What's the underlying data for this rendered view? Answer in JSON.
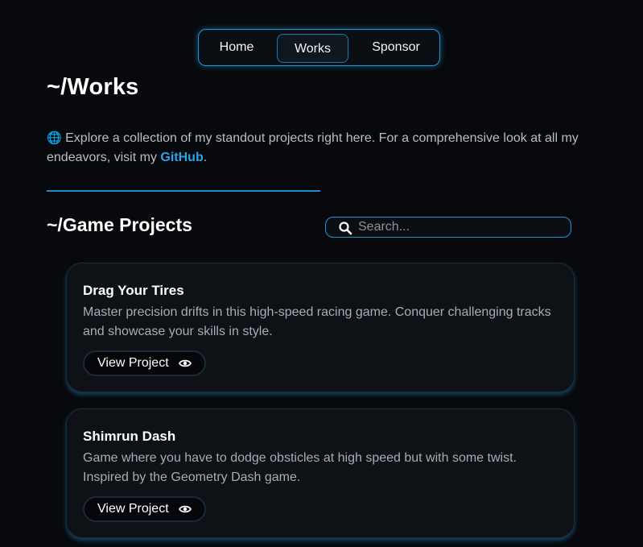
{
  "nav": {
    "items": [
      {
        "label": "Home"
      },
      {
        "label": "Works"
      },
      {
        "label": "Sponsor"
      }
    ]
  },
  "header": {
    "title": "~/Works"
  },
  "intro": {
    "globe": "🌐",
    "text_before": " Explore a collection of my standout projects right here. For a comprehensive look at all my endeavors, visit my ",
    "link_label": "GitHub",
    "text_after": "."
  },
  "section": {
    "title": "~/Game Projects"
  },
  "search": {
    "placeholder": "Search...",
    "icon": "search-icon"
  },
  "projects": [
    {
      "title": "Drag Your Tires",
      "description": "Master precision drifts in this high-speed racing game. Conquer challenging tracks and showcase your skills in style.",
      "button_label": "View Project",
      "button_icon": "eye-icon"
    },
    {
      "title": "Shimrun Dash",
      "description": "Game where you have to dodge obsticles at high speed but with some twist. Inspired by the Geometry Dash game.",
      "button_label": "View Project",
      "button_icon": "eye-icon"
    }
  ],
  "colors": {
    "background": "#07090c",
    "accent": "#1f93d6",
    "link": "#2ea3e8",
    "card": "#0e1116"
  }
}
